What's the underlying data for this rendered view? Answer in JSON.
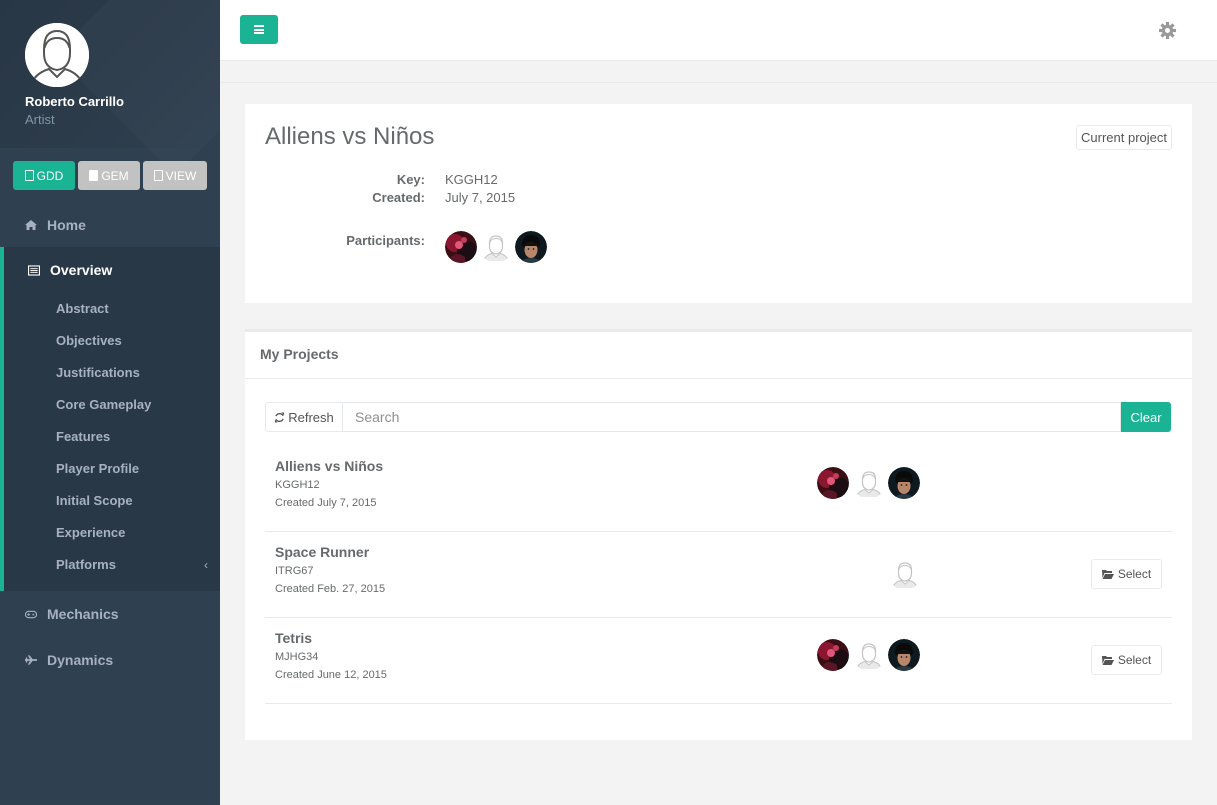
{
  "user": {
    "name": "Roberto Carrillo",
    "role": "Artist"
  },
  "doc_buttons": [
    {
      "label": "GDD",
      "icon": "file-icon",
      "style": "primary"
    },
    {
      "label": "GEM",
      "icon": "file-filled-icon",
      "style": "grey"
    },
    {
      "label": "VIEW",
      "icon": "file-pdf-icon",
      "style": "grey"
    }
  ],
  "nav": {
    "home": "Home",
    "overview": "Overview",
    "sub_items": [
      "Abstract",
      "Objectives",
      "Justifications",
      "Core Gameplay",
      "Features",
      "Player Profile",
      "Initial Scope",
      "Experience",
      "Platforms"
    ],
    "mechanics": "Mechanics",
    "dynamics": "Dynamics"
  },
  "current_project": {
    "title": "Alliens vs Niños",
    "badge": "Current project",
    "key_label": "Key:",
    "key": "KGGH12",
    "created_label": "Created:",
    "created": "July 7, 2015",
    "participants_label": "Participants:"
  },
  "projects_panel": {
    "title": "My Projects",
    "refresh_label": "Refresh",
    "search_placeholder": "Search",
    "clear_label": "Clear",
    "select_label": "Select",
    "rows": [
      {
        "name": "Alliens vs Niños",
        "key": "KGGH12",
        "created": "Created July 7, 2015",
        "is_current": true,
        "avatars": [
          "photo-girl",
          "placeholder",
          "photo-boy"
        ]
      },
      {
        "name": "Space Runner",
        "key": "ITRG67",
        "created": "Created Feb. 27, 2015",
        "is_current": false,
        "avatars": [
          "placeholder"
        ]
      },
      {
        "name": "Tetris",
        "key": "MJHG34",
        "created": "Created June 12, 2015",
        "is_current": false,
        "avatars": [
          "photo-girl",
          "placeholder",
          "photo-boy"
        ]
      }
    ]
  },
  "colors": {
    "accent": "#1ab394",
    "sidebar": "#2f4050",
    "sidebar_active": "#293846",
    "text": "#676a6c"
  }
}
